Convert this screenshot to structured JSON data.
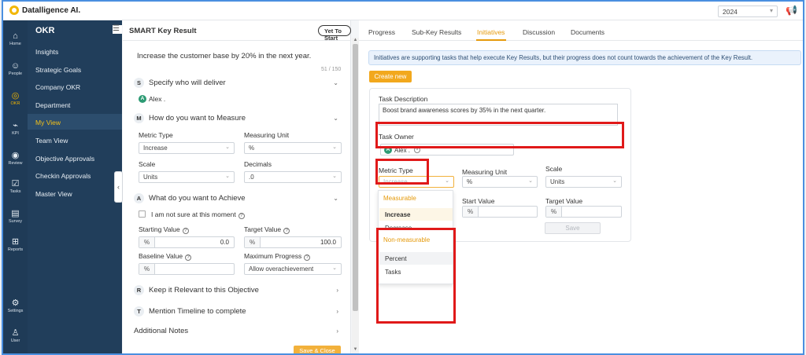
{
  "app": {
    "logo_text": "Datalligence AI.",
    "year": "2024"
  },
  "rail": [
    {
      "label": "Home",
      "icon": "home-icon",
      "glyph": "⌂"
    },
    {
      "label": "People",
      "icon": "people-icon",
      "glyph": "☺"
    },
    {
      "label": "OKR",
      "icon": "okr-icon",
      "glyph": "◎"
    },
    {
      "label": "KPI",
      "icon": "kpi-icon",
      "glyph": "⌁"
    },
    {
      "label": "Review",
      "icon": "review-icon",
      "glyph": "◉"
    },
    {
      "label": "Tasks",
      "icon": "tasks-icon",
      "glyph": "☑"
    },
    {
      "label": "Survey",
      "icon": "survey-icon",
      "glyph": "▤"
    },
    {
      "label": "Reports",
      "icon": "reports-icon",
      "glyph": "⊞"
    },
    {
      "label": "Settings",
      "icon": "settings-icon",
      "glyph": "⚙"
    },
    {
      "label": "User",
      "icon": "user-icon",
      "glyph": "♙"
    }
  ],
  "nav": {
    "title": "OKR",
    "items": [
      "Insights",
      "Strategic Goals",
      "Company OKR",
      "Department",
      "My View",
      "Team View",
      "Objective Approvals",
      "Checkin Approvals",
      "Master View"
    ],
    "active": "My View"
  },
  "left": {
    "header": "SMART Key Result",
    "status": "Yet To Start",
    "kr_text": "Increase the customer base by 20% in the next year.",
    "char_count": "51 / 150",
    "sections": {
      "s": {
        "letter": "S",
        "title": "Specify who will deliver"
      },
      "m": {
        "letter": "M",
        "title": "How do you want to Measure"
      },
      "a": {
        "letter": "A",
        "title": "What do you want to Achieve"
      },
      "r": {
        "letter": "R",
        "title": "Keep it Relevant to this Objective"
      },
      "t": {
        "letter": "T",
        "title": "Mention Timeline to complete"
      }
    },
    "owner": {
      "initial": "A",
      "name": "Alex ."
    },
    "metric_type_label": "Metric Type",
    "metric_type_value": "Increase",
    "measuring_unit_label": "Measuring Unit",
    "measuring_unit_value": "%",
    "scale_label": "Scale",
    "scale_value": "Units",
    "decimals_label": "Decimals",
    "decimals_value": ".0",
    "not_sure_label": "I am not sure at this moment",
    "starting_label": "Starting Value",
    "starting_value": "0.0",
    "target_label": "Target Value",
    "target_value": "100.0",
    "baseline_label": "Baseline Value",
    "max_progress_label": "Maximum Progress",
    "max_progress_value": "Allow overachievement",
    "additional_notes": "Additional Notes",
    "save_close": "Save & Close",
    "prefix": "%"
  },
  "right": {
    "tabs": [
      "Progress",
      "Sub-Key Results",
      "Initiatives",
      "Discussion",
      "Documents"
    ],
    "active_tab": "Initiatives",
    "info": "Initiatives are supporting tasks that help execute Key Results, but their progress does not count towards the achievement of the Key Result.",
    "create_new": "Create new",
    "task_description_label": "Task Description",
    "task_description_value": "Boost brand awareness scores by 35% in the next quarter.",
    "task_owner_label": "Task Owner",
    "owner": {
      "initial": "A",
      "name": "Alex ."
    },
    "metric_type_label": "Metric Type",
    "metric_type_placeholder": "Increase",
    "measuring_unit_label": "Measuring Unit",
    "measuring_unit_value": "%",
    "scale_label": "Scale",
    "scale_value": "Units",
    "start_value_label": "Start Value",
    "target_value_label": "Target Value",
    "prefix": "%",
    "save": "Save",
    "dropdown": {
      "group1": "Measurable",
      "group1_options": [
        "Increase",
        "Decrease"
      ],
      "group2": "Non-measurable",
      "group2_options": [
        "Percent",
        "Tasks"
      ]
    }
  },
  "colors": {
    "accent": "#f2a81d",
    "nav_bg": "#213e5b",
    "highlight": "#e01919",
    "avatar": "#2d9b74"
  }
}
